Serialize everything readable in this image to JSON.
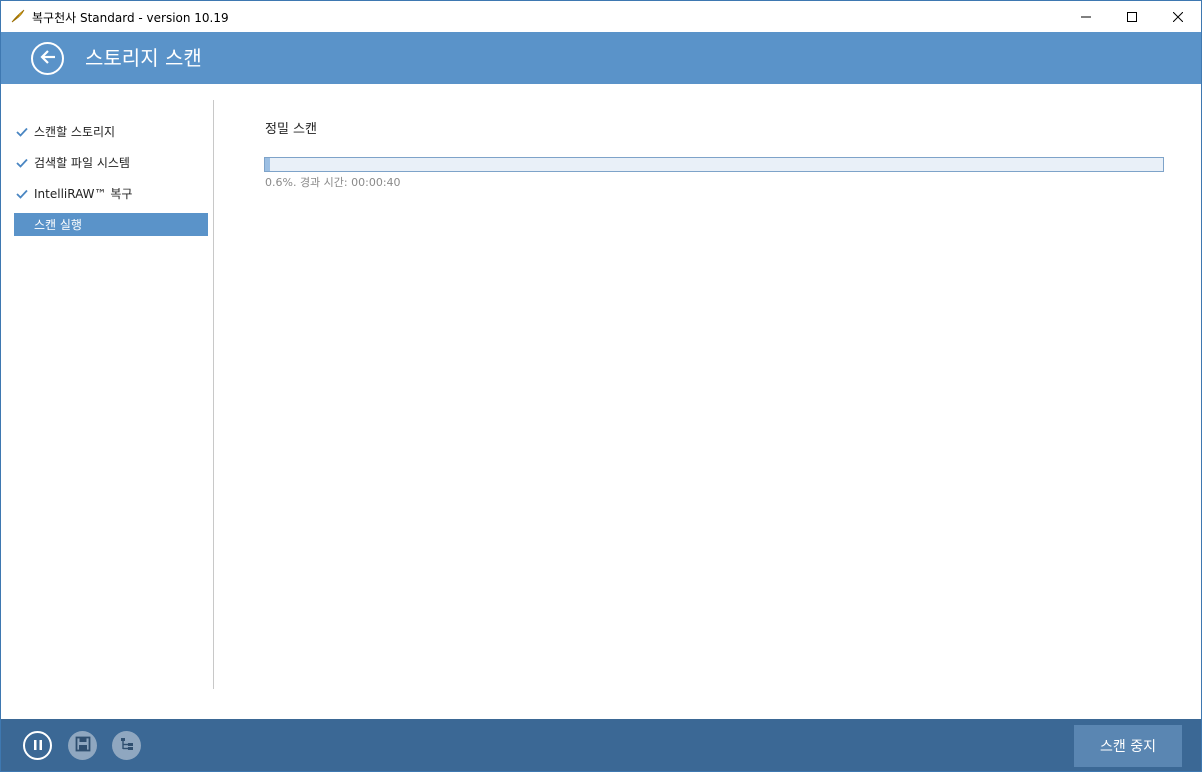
{
  "window": {
    "title": "복구천사 Standard - version 10.19"
  },
  "header": {
    "title": "스토리지 스캔"
  },
  "sidebar": {
    "steps": [
      {
        "label": "스캔할 스토리지",
        "done": true
      },
      {
        "label": "검색할 파일 시스템",
        "done": true
      },
      {
        "label": "IntelliRAW™ 복구",
        "done": true
      },
      {
        "label": "스캔 실행",
        "done": false,
        "active": true
      }
    ]
  },
  "main": {
    "section_title": "정밀 스캔",
    "progress": {
      "percent": 0.6,
      "status_text": "0.6%. 경과 시간: 00:00:40"
    }
  },
  "footer": {
    "stop_label": "스캔 중지"
  },
  "colors": {
    "accent": "#5a93c9",
    "footer": "#3b6895",
    "stop_button": "#5a86b2",
    "progress_fill": "#9cbfe3"
  },
  "icons": {
    "app": "angel-feather-icon",
    "back": "back-arrow-icon",
    "check": "check-icon",
    "pause": "pause-icon",
    "save": "save-disk-icon",
    "tree": "tree-view-icon"
  }
}
